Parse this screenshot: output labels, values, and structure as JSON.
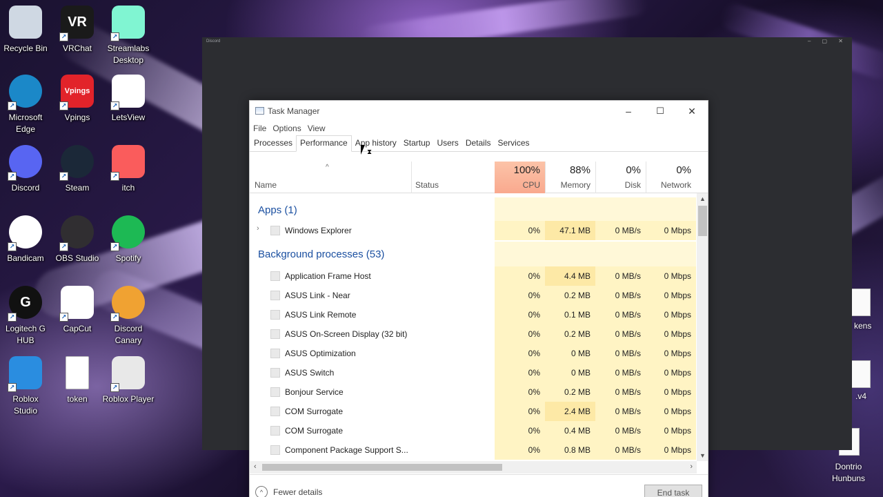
{
  "desktop": {
    "icons": [
      {
        "label": "Recycle Bin",
        "icon": "recycle-bin-icon",
        "color": "#cfd8e3"
      },
      {
        "label": "VRChat",
        "icon": "vrchat-icon",
        "color": "#1a1a1a",
        "glyph": "VR"
      },
      {
        "label": "Streamlabs\nDesktop",
        "icon": "streamlabs-icon",
        "color": "#80f5d2"
      },
      {
        "label": "Microsoft\nEdge",
        "icon": "edge-icon",
        "color": "#1b88c8"
      },
      {
        "label": "Vpings",
        "icon": "vpings-icon",
        "color": "#e2232a",
        "glyph": "Vpings"
      },
      {
        "label": "LetsView",
        "icon": "letsview-icon",
        "color": "#ffffff"
      },
      {
        "label": "Discord",
        "icon": "discord-icon",
        "color": "#5865f2"
      },
      {
        "label": "Steam",
        "icon": "steam-icon",
        "color": "#1b2838"
      },
      {
        "label": "itch",
        "icon": "itch-icon",
        "color": "#fa5c5c"
      },
      {
        "label": "Bandicam",
        "icon": "bandicam-icon",
        "color": "#ffffff"
      },
      {
        "label": "OBS Studio",
        "icon": "obs-icon",
        "color": "#302e31"
      },
      {
        "label": "Spotify",
        "icon": "spotify-icon",
        "color": "#1db954"
      },
      {
        "label": "Logitech G\nHUB",
        "icon": "logitech-icon",
        "color": "#111111",
        "glyph": "G"
      },
      {
        "label": "CapCut",
        "icon": "capcut-icon",
        "color": "#ffffff"
      },
      {
        "label": "Discord\nCanary",
        "icon": "discord-canary-icon",
        "color": "#f0a232"
      },
      {
        "label": "Roblox\nStudio",
        "icon": "roblox-studio-icon",
        "color": "#2a8de0"
      },
      {
        "label": "token",
        "icon": "text-file-icon",
        "color": "#ffffff"
      },
      {
        "label": "Roblox Player",
        "icon": "roblox-player-icon",
        "color": "#e8e8e8"
      }
    ],
    "right_labels": {
      "partial1": "kens",
      "partial2": ".v4",
      "dontrio": "Dontrio\nHunbuns"
    }
  },
  "discord_window": {
    "title": "Discord"
  },
  "task_manager": {
    "title": "Task Manager",
    "menu": [
      "File",
      "Options",
      "View"
    ],
    "tabs": [
      "Processes",
      "Performance",
      "App history",
      "Startup",
      "Users",
      "Details",
      "Services"
    ],
    "active_tab": "Performance",
    "columns": {
      "name": "Name",
      "status": "Status",
      "cpu": {
        "pct": "100%",
        "label": "CPU"
      },
      "memory": {
        "pct": "88%",
        "label": "Memory"
      },
      "disk": {
        "pct": "0%",
        "label": "Disk"
      },
      "network": {
        "pct": "0%",
        "label": "Network"
      }
    },
    "groups": {
      "apps": "Apps (1)",
      "background": "Background processes (53)"
    },
    "apps": [
      {
        "name": "Windows Explorer",
        "cpu": "0%",
        "memory": "47.1 MB",
        "disk": "0 MB/s",
        "network": "0 Mbps"
      }
    ],
    "background": [
      {
        "name": "Application Frame Host",
        "cpu": "0%",
        "memory": "4.4 MB",
        "disk": "0 MB/s",
        "network": "0 Mbps"
      },
      {
        "name": "ASUS Link - Near",
        "cpu": "0%",
        "memory": "0.2 MB",
        "disk": "0 MB/s",
        "network": "0 Mbps"
      },
      {
        "name": "ASUS Link Remote",
        "cpu": "0%",
        "memory": "0.1 MB",
        "disk": "0 MB/s",
        "network": "0 Mbps"
      },
      {
        "name": "ASUS On-Screen Display (32 bit)",
        "cpu": "0%",
        "memory": "0.2 MB",
        "disk": "0 MB/s",
        "network": "0 Mbps"
      },
      {
        "name": "ASUS Optimization",
        "cpu": "0%",
        "memory": "0 MB",
        "disk": "0 MB/s",
        "network": "0 Mbps"
      },
      {
        "name": "ASUS Switch",
        "cpu": "0%",
        "memory": "0 MB",
        "disk": "0 MB/s",
        "network": "0 Mbps"
      },
      {
        "name": "Bonjour Service",
        "cpu": "0%",
        "memory": "0.2 MB",
        "disk": "0 MB/s",
        "network": "0 Mbps"
      },
      {
        "name": "COM Surrogate",
        "cpu": "0%",
        "memory": "2.4 MB",
        "disk": "0 MB/s",
        "network": "0 Mbps"
      },
      {
        "name": "COM Surrogate",
        "cpu": "0%",
        "memory": "0.4 MB",
        "disk": "0 MB/s",
        "network": "0 Mbps"
      },
      {
        "name": "Component Package Support S...",
        "cpu": "0%",
        "memory": "0.8 MB",
        "disk": "0 MB/s",
        "network": "0 Mbps"
      }
    ],
    "footer": {
      "fewer_details": "Fewer details",
      "end_task": "End task"
    }
  }
}
